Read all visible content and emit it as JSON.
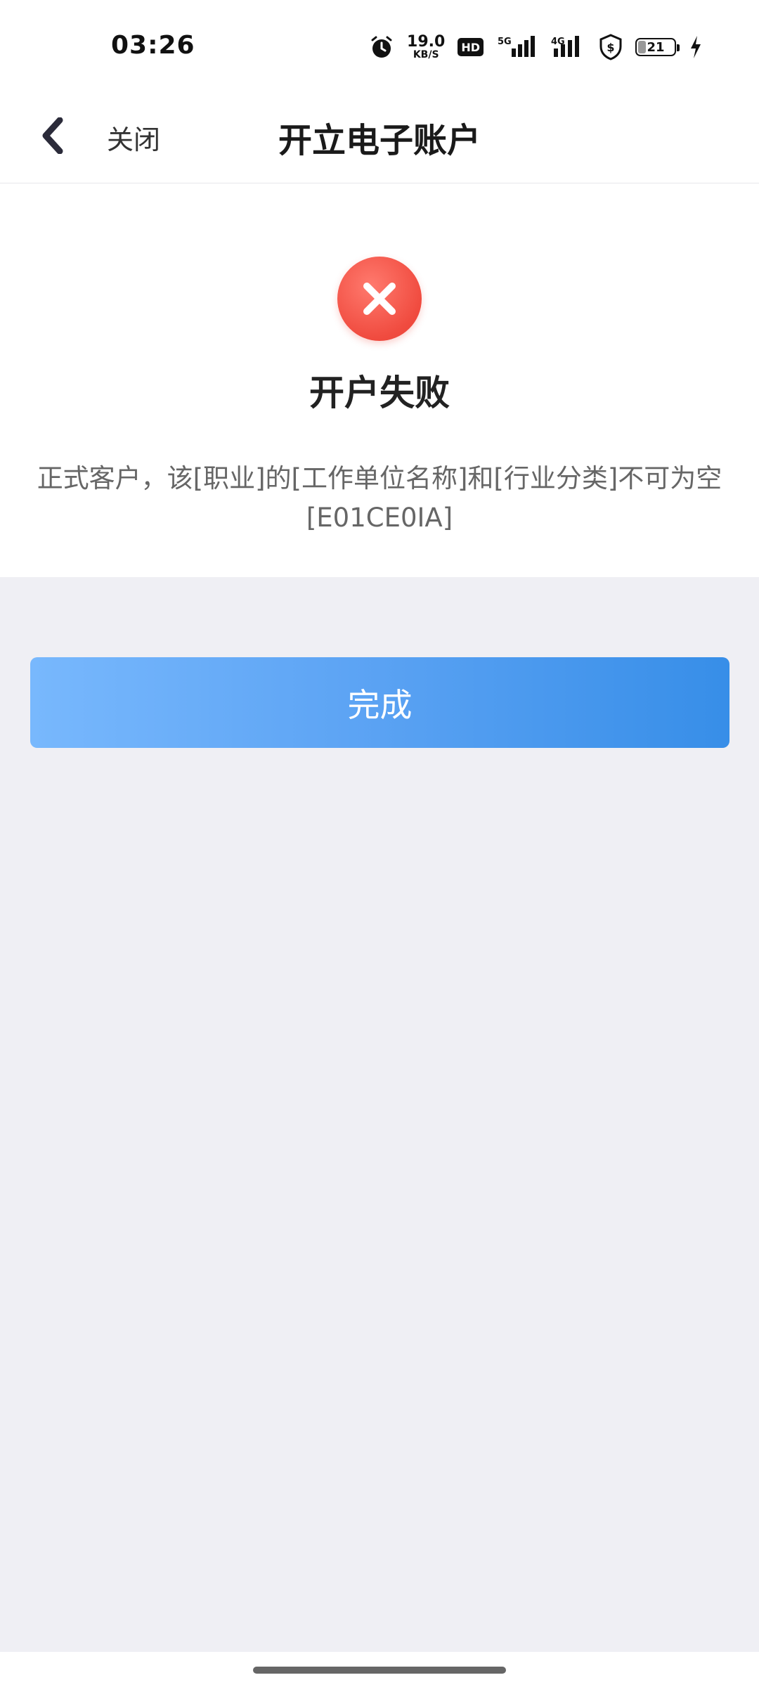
{
  "status_bar": {
    "time": "03:26",
    "net_speed_value": "19.0",
    "net_speed_unit": "KB/S",
    "hd_label": "HD",
    "signal_1_label": "5G",
    "signal_2_label": "4G",
    "battery_level": "21",
    "icons": [
      "alarm-icon",
      "hd-icon",
      "signal-5g-icon",
      "signal-4g-icon",
      "shield-dollar-icon",
      "battery-icon",
      "charging-icon"
    ]
  },
  "header": {
    "back_icon": "chevron-left-icon",
    "close_label": "关闭",
    "title": "开立电子账户"
  },
  "result": {
    "icon": "close-circle-icon",
    "icon_color": "#f04b3f",
    "title": "开户失败",
    "message": "正式客户，该[职业]的[工作单位名称]和[行业分类]不可为空",
    "error_code": "[E01CE0IA]"
  },
  "actions": {
    "done_label": "完成",
    "done_gradient_start": "#78b8fd",
    "done_gradient_end": "#378ee8"
  },
  "colors": {
    "page_background": "#efeff4",
    "surface": "#ffffff"
  }
}
